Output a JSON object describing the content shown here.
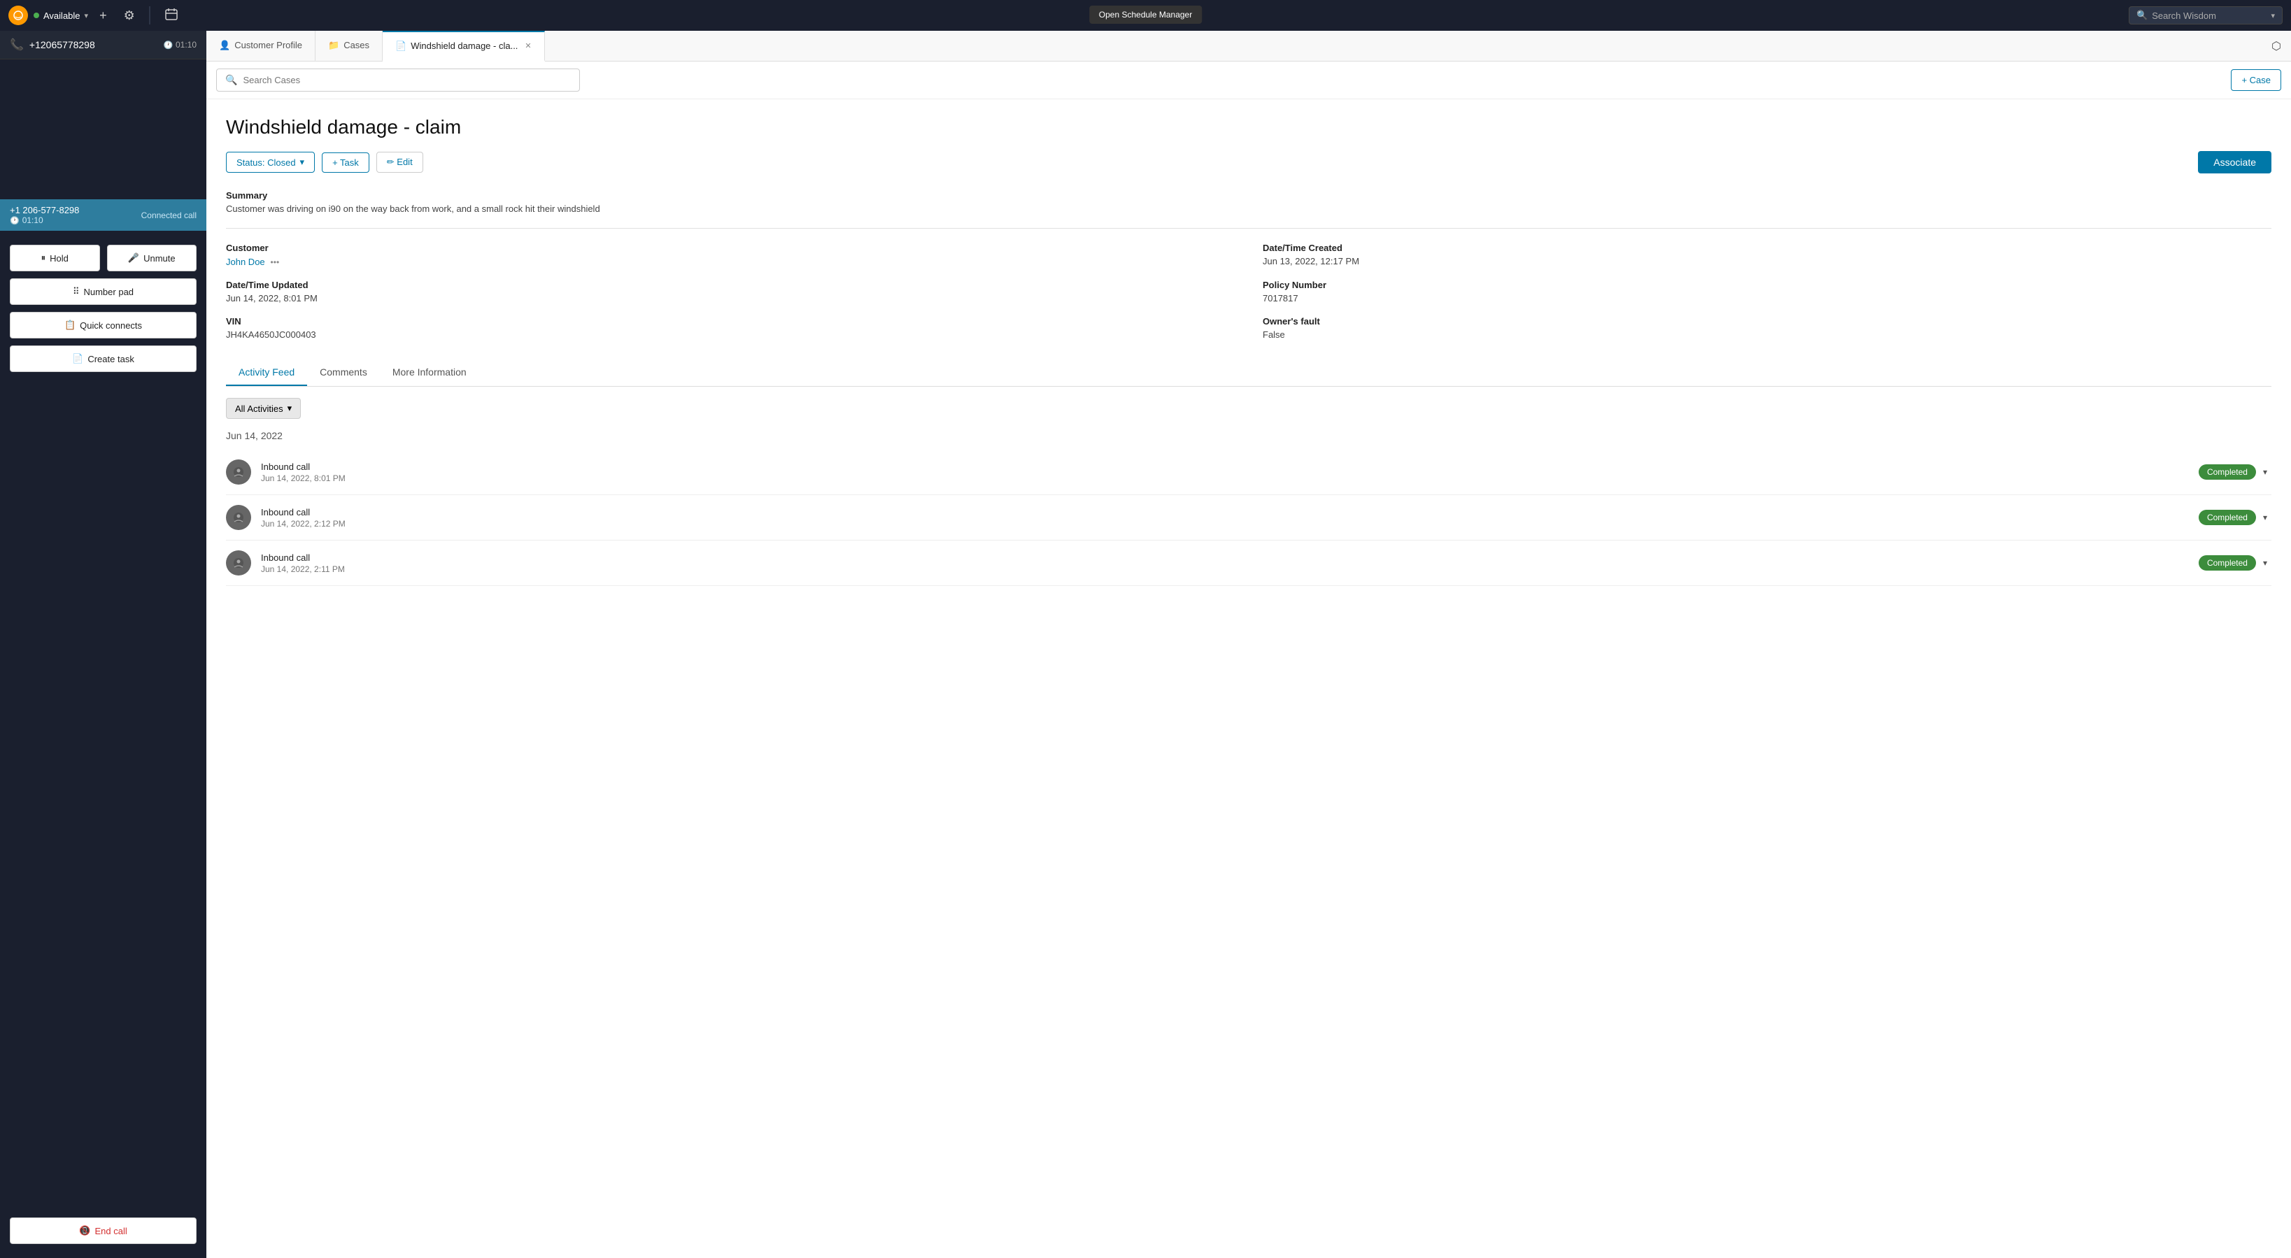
{
  "app": {
    "title": "Amazon Connect"
  },
  "topNav": {
    "status": "Available",
    "searchPlaceholder": "Search Wisdom",
    "scheduleTooltip": "Open Schedule Manager"
  },
  "ccp": {
    "phoneNumber": "+12065778298",
    "timer": "01:10",
    "connectedNumber": "+1 206-577-8298",
    "connectedTimer": "01:10",
    "connectedLabel": "Connected call",
    "holdLabel": "Hold",
    "unmuteLabel": "Unmute",
    "numberPadLabel": "Number pad",
    "quickConnectsLabel": "Quick connects",
    "createTaskLabel": "Create task",
    "endCallLabel": "End call"
  },
  "tabs": {
    "customerProfile": "Customer Profile",
    "cases": "Cases",
    "windshieldCase": "Windshield damage - cla...",
    "shareIcon": "⬡"
  },
  "searchCases": {
    "placeholder": "Search Cases",
    "addCaseLabel": "+ Case"
  },
  "caseDetail": {
    "title": "Windshield damage - claim",
    "statusLabel": "Status: Closed",
    "taskLabel": "+ Task",
    "editLabel": "✏ Edit",
    "associateLabel": "Associate",
    "summaryLabel": "Summary",
    "summaryText": "Customer was driving on i90 on the way back from work, and a small rock hit their windshield",
    "customerLabel": "Customer",
    "customerValue": "John Doe",
    "dateCreatedLabel": "Date/Time Created",
    "dateCreatedValue": "Jun 13, 2022, 12:17 PM",
    "dateUpdatedLabel": "Date/Time Updated",
    "dateUpdatedValue": "Jun 14, 2022, 8:01 PM",
    "policyNumberLabel": "Policy Number",
    "policyNumberValue": "7017817",
    "vinLabel": "VIN",
    "vinValue": "JH4KA4650JC000403",
    "ownersFaultLabel": "Owner's fault",
    "ownersFaultValue": "False"
  },
  "activityFeed": {
    "tabLabel": "Activity Feed",
    "commentsLabel": "Comments",
    "moreInfoLabel": "More Information",
    "allActivitiesLabel": "All Activities",
    "dateHeader": "Jun 14, 2022",
    "activities": [
      {
        "title": "Inbound call",
        "time": "Jun 14, 2022, 8:01 PM",
        "status": "Completed"
      },
      {
        "title": "Inbound call",
        "time": "Jun 14, 2022, 2:12 PM",
        "status": "Completed"
      },
      {
        "title": "Inbound call",
        "time": "Jun 14, 2022, 2:11 PM",
        "status": "Completed"
      }
    ]
  }
}
